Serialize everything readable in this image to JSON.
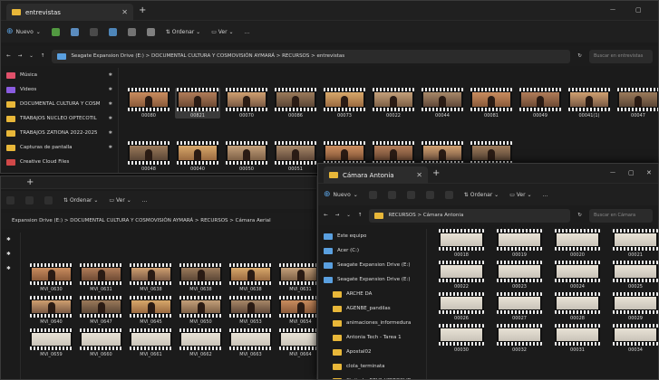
{
  "colors": {
    "folder": "#e8b739",
    "drive": "#5aa0e0"
  },
  "win1": {
    "tab_title": "entrevistas",
    "toolbar": [
      "Nuevo",
      "Ordenar",
      "Ver",
      "..."
    ],
    "path": "Seagate Expansion Drive (E:)  >  DOCUMENTAL CULTURA Y COSMOVISIÓN AYMARÁ  >  RECURSOS  >  entrevistas",
    "search": "Buscar en entrevistas",
    "nav": [
      {
        "label": "Música",
        "icon": "music"
      },
      {
        "label": "Videos",
        "icon": "video"
      },
      {
        "label": "DOCUMENTAL CULTURA Y COSM",
        "icon": "folder"
      },
      {
        "label": "TRABAJOS NUCLEO OPTECOTIL",
        "icon": "folder"
      },
      {
        "label": "TRABAJOS ZATIONA 2022-2025",
        "icon": "folder"
      },
      {
        "label": "Capturas de pantalla",
        "icon": "folder"
      },
      {
        "label": "Creative Cloud Files",
        "icon": "cloud"
      }
    ],
    "row1": [
      "00080",
      "00821",
      "00070",
      "00086",
      "00073",
      "00022",
      "00044",
      "00081",
      "00049",
      "00041(1)",
      "00047"
    ],
    "row2": [
      "00048",
      "00040",
      "00050",
      "00051",
      "",
      "",
      "",
      ""
    ]
  },
  "win2": {
    "toolbar": [
      "Ordenar",
      "Ver",
      "..."
    ],
    "path": "Expansion Drive (E:)  >  DOCUMENTAL CULTURA Y COSMOVISIÓN AYMARÁ  >  RECURSOS  >  Cámara Aerial",
    "row1": [
      "MVI_0630",
      "MVI_0631",
      "MVI_0638",
      "MVI_0638",
      "MVI_0638",
      "MVI_0631"
    ],
    "row2": [
      "MVI_0640",
      "MVI_0647",
      "MVI_0645",
      "MVI_0650",
      "MVI_0653",
      "MVI_0654"
    ],
    "row3": [
      "MVI_0659",
      "MVI_0660",
      "MVI_0661",
      "MVI_0662",
      "MVI_0663",
      "MVI_0664"
    ]
  },
  "win3": {
    "tab_title": "Cámara Antonia",
    "toolbar": [
      "Nuevo",
      "Ordenar",
      "Ver",
      "..."
    ],
    "path": "RECURSOS  >  Cámara Antonia",
    "search": "Buscar en Cámara",
    "nav": [
      {
        "label": "Este equipo",
        "icon": "pc"
      },
      {
        "label": "Acer (C:)",
        "icon": "drive"
      },
      {
        "label": "Seagate Expansion Drive (E:)",
        "icon": "drive"
      },
      {
        "label": "Seagate Expansion Drive (E:)",
        "icon": "drive"
      },
      {
        "label": "ARCHE DA",
        "icon": "folder"
      },
      {
        "label": "AGENBE_pandilas",
        "icon": "folder"
      },
      {
        "label": "animaciones_informedura",
        "icon": "folder"
      },
      {
        "label": "Antonia Tech - Tarea 1",
        "icon": "folder"
      },
      {
        "label": "Apostal02",
        "icon": "folder"
      },
      {
        "label": "clola_terminata",
        "icon": "folder"
      },
      {
        "label": "Cigitado_REVA VIDEOCLIP",
        "icon": "folder"
      }
    ],
    "row1": [
      "00018",
      "00019",
      "00020",
      "00021"
    ],
    "row2": [
      "00022",
      "00023",
      "00024",
      "00025"
    ],
    "row3": [
      "00026",
      "00027",
      "00028",
      "00029"
    ],
    "row4": [
      "00030",
      "00032",
      "00031",
      "00034"
    ]
  }
}
